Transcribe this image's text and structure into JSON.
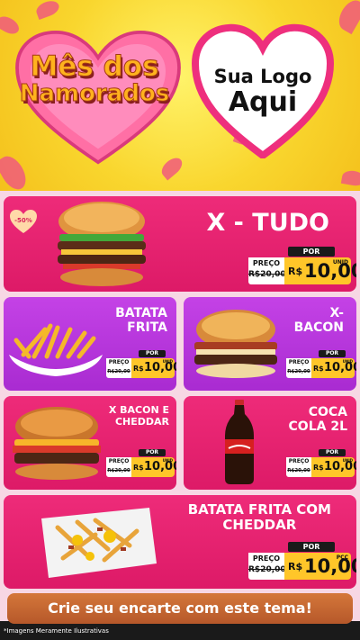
{
  "header": {
    "title_line1": "Mês dos",
    "title_line2": "Namorados",
    "logo_line1": "Sua Logo",
    "logo_line2": "Aqui"
  },
  "badge": {
    "discount": "-50%"
  },
  "products": [
    {
      "name": "X - TUDO",
      "preco_label": "PREÇO",
      "old_price": "R$20,00",
      "por_label": "POR",
      "currency": "R$",
      "price": "10,00",
      "unit": "UNID"
    },
    {
      "name_l1": "BATATA",
      "name_l2": "FRITA",
      "preco_label": "PREÇO",
      "old_price": "R$20,00",
      "por_label": "POR",
      "currency": "R$",
      "price": "10,00",
      "unit": "UNID"
    },
    {
      "name_l1": "X-",
      "name_l2": "BACON",
      "preco_label": "PREÇO",
      "old_price": "R$20,00",
      "por_label": "POR",
      "currency": "R$",
      "price": "10,00",
      "unit": "UNID"
    },
    {
      "name_l1": "X BACON E",
      "name_l2": "CHEDDAR",
      "preco_label": "PREÇO",
      "old_price": "R$20,00",
      "por_label": "POR",
      "currency": "R$",
      "price": "10,00",
      "unit": "UNID"
    },
    {
      "name_l1": "COCA",
      "name_l2": "COLA 2L",
      "preco_label": "PREÇO",
      "old_price": "R$20,00",
      "por_label": "POR",
      "currency": "R$",
      "price": "10,00",
      "unit": "UNID"
    },
    {
      "name_l1": "BATATA FRITA COM",
      "name_l2": "CHEDDAR",
      "preco_label": "PREÇO",
      "old_price": "R$20,00",
      "por_label": "POR",
      "currency": "R$",
      "price": "10,00",
      "unit": "PÇC"
    }
  ],
  "footer": {
    "cta": "Crie seu encarte com este tema!",
    "disclaimer": "*Imagens Meramente Ilustrativas"
  }
}
